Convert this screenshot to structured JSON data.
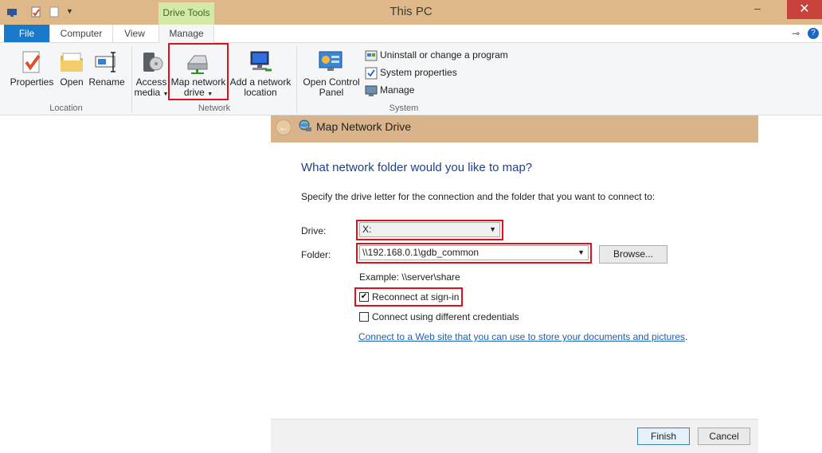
{
  "window": {
    "title": "This PC",
    "context_tab": "Drive Tools",
    "minimize": "–",
    "close": "✕",
    "pin": "⊸",
    "help": "?"
  },
  "ribbon": {
    "tabs": [
      "File",
      "Computer",
      "View",
      "Manage"
    ],
    "location": {
      "label": "Location",
      "buttons": [
        {
          "label": "Properties",
          "icon": "properties-icon"
        },
        {
          "label": "Open",
          "icon": "open-folder-icon"
        },
        {
          "label": "Rename",
          "icon": "rename-icon"
        }
      ]
    },
    "network": {
      "label": "Network",
      "access_media": [
        "Access",
        "media"
      ],
      "map_drive": [
        "Map network",
        "drive"
      ],
      "add_location": [
        "Add a network",
        "location"
      ]
    },
    "system": {
      "label": "System",
      "open_cp": [
        "Open Control",
        "Panel"
      ],
      "items": [
        "Uninstall or change a program",
        "System properties",
        "Manage"
      ]
    }
  },
  "dialog": {
    "title": "Map Network Drive",
    "heading": "What network folder would you like to map?",
    "description": "Specify the drive letter for the connection and the folder that you want to connect to:",
    "drive_label": "Drive:",
    "drive_value": "X:",
    "folder_label": "Folder:",
    "folder_value": "\\\\192.168.0.1\\gdb_common",
    "browse": "Browse...",
    "example": "Example: \\\\server\\share",
    "reconnect": {
      "label": "Reconnect at sign-in",
      "checked": true
    },
    "credentials": {
      "label": "Connect using different credentials",
      "checked": false
    },
    "link": "Connect to a Web site that you can use to store your documents and pictures",
    "link_suffix": ".",
    "finish": "Finish",
    "cancel": "Cancel"
  },
  "colors": {
    "titlebar": "#dfb88a",
    "dialog_header": "#d9b48a",
    "file_tab": "#1979ca",
    "highlight": "#e0101b",
    "heading": "#1e3f8c"
  }
}
